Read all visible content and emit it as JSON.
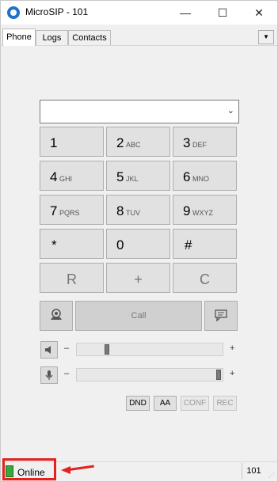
{
  "window": {
    "title": "MicroSIP - 101",
    "controls": {
      "minimize": "—",
      "maximize": "☐",
      "close": "✕"
    }
  },
  "tabs": [
    {
      "label": "Phone",
      "active": true
    },
    {
      "label": "Logs",
      "active": false
    },
    {
      "label": "Contacts",
      "active": false
    }
  ],
  "tab_menu_glyph": "▼",
  "dialer": {
    "number_value": "",
    "dropdown_glyph": "⌄"
  },
  "keypad": [
    {
      "digit": "1",
      "letters": ""
    },
    {
      "digit": "2",
      "letters": "ABC"
    },
    {
      "digit": "3",
      "letters": "DEF"
    },
    {
      "digit": "4",
      "letters": "GHI"
    },
    {
      "digit": "5",
      "letters": "JKL"
    },
    {
      "digit": "6",
      "letters": "MNO"
    },
    {
      "digit": "7",
      "letters": "PQRS"
    },
    {
      "digit": "8",
      "letters": "TUV"
    },
    {
      "digit": "9",
      "letters": "WXYZ"
    },
    {
      "digit": "*",
      "letters": ""
    },
    {
      "digit": "0",
      "letters": ""
    },
    {
      "digit": "#",
      "letters": ""
    }
  ],
  "function_keys": {
    "redial": "R",
    "plus": "+",
    "clear": "C"
  },
  "call": {
    "label": "Call",
    "left_icon": "video-call-icon",
    "right_icon": "message-icon"
  },
  "speaker": {
    "icon": "speaker-icon",
    "minus": "–",
    "plus": "+",
    "level": 0.2
  },
  "microphone": {
    "icon": "microphone-icon",
    "minus": "–",
    "plus": "+",
    "level": 1.0
  },
  "options": {
    "dnd": "DND",
    "aa": "AA",
    "conf": "CONF",
    "rec": "REC"
  },
  "status": {
    "text": "Online",
    "icon": "online-status-icon",
    "extension": "101",
    "highlight_color": "#e3211f",
    "online_color": "#3ca53c"
  }
}
